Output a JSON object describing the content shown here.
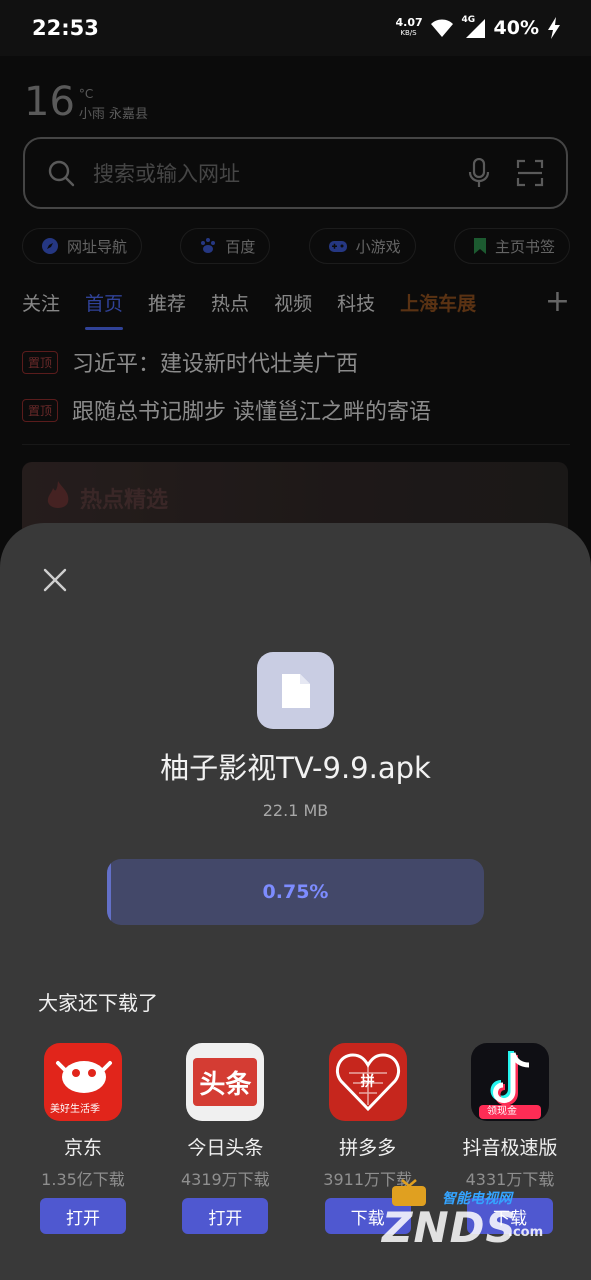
{
  "status_bar": {
    "time": "22:53",
    "net_speed_value": "4.07",
    "net_speed_unit": "KB/S",
    "network_type": "4G",
    "battery": "40%"
  },
  "weather": {
    "temperature": "16",
    "unit": "°C",
    "condition": "小雨 永嘉县"
  },
  "search": {
    "placeholder": "搜索或输入网址"
  },
  "quick_links": [
    {
      "label": "网址导航",
      "icon": "compass-icon"
    },
    {
      "label": "百度",
      "icon": "baidu-paw-icon"
    },
    {
      "label": "小游戏",
      "icon": "gamepad-icon"
    },
    {
      "label": "主页书签",
      "icon": "bookmark-icon"
    }
  ],
  "tabs": [
    "关注",
    "首页",
    "推荐",
    "热点",
    "视频",
    "科技",
    "上海车展"
  ],
  "active_tab": "首页",
  "news": [
    {
      "tag": "置顶",
      "title": "习近平：建设新时代壮美广西"
    },
    {
      "tag": "置顶",
      "title": "跟随总书记脚步 读懂邕江之畔的寄语"
    }
  ],
  "hot_card": {
    "title": "热点精选"
  },
  "download_sheet": {
    "file_name": "柚子影视TV-9.9.apk",
    "file_size": "22.1 MB",
    "progress_text": "0.75%",
    "progress_fraction": 0.0075,
    "recommend_title": "大家还下载了",
    "apps": [
      {
        "name": "京东",
        "downloads": "1.35亿下载",
        "button": "打开",
        "icon_label": "美好生活季",
        "color": "#e1251b"
      },
      {
        "name": "今日头条",
        "downloads": "4319万下载",
        "button": "打开",
        "icon_label": "头条",
        "color": "#d43c33"
      },
      {
        "name": "拼多多",
        "downloads": "3911万下载",
        "button": "下载",
        "icon_label": "拼",
        "color": "#c6261d"
      },
      {
        "name": "抖音极速版",
        "downloads": "4331万下载",
        "button": "下载",
        "icon_label": "领现金",
        "color": "#0f0f14"
      }
    ]
  },
  "watermark": {
    "tag": "智能电视网",
    "main": "ZNDS",
    "domain": ".com"
  },
  "colors": {
    "accent": "#4a66e8",
    "button": "#4f58d0",
    "sheet_bg": "#393939"
  }
}
